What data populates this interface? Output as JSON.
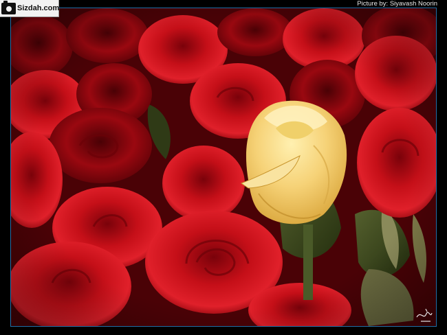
{
  "watermark": {
    "logo_icon": "camera-icon",
    "site": "Sizdah.com"
  },
  "credit": {
    "text": "Picture by: Siyavash Noorin"
  },
  "colors": {
    "frame": "#000000",
    "border": "#1f6fa8",
    "rose_red": "#c8101a",
    "rose_yellow": "#f2cf6a",
    "leaf_green": "#3d4a22"
  },
  "photo": {
    "subject_icon": "rose-bouquet-photo"
  }
}
